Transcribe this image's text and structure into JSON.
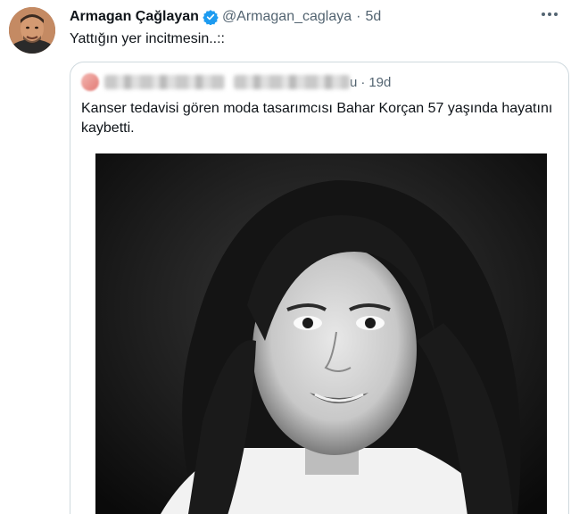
{
  "tweet": {
    "display_name": "Armagan Çağlayan",
    "handle": "@Armagan_caglaya",
    "separator": "·",
    "time": "5d",
    "text": "Yattığın yer incitmesin..::",
    "verified_color": "#1d9bf0"
  },
  "quote": {
    "trailing_letter": "u",
    "separator": "·",
    "time": "19d",
    "text": "Kanser tedavisi gören moda tasarımcısı Bahar Korçan 57 yaşında hayatını kaybetti."
  },
  "icons": {
    "verified": "verified-badge-icon",
    "more": "more-options-icon"
  }
}
